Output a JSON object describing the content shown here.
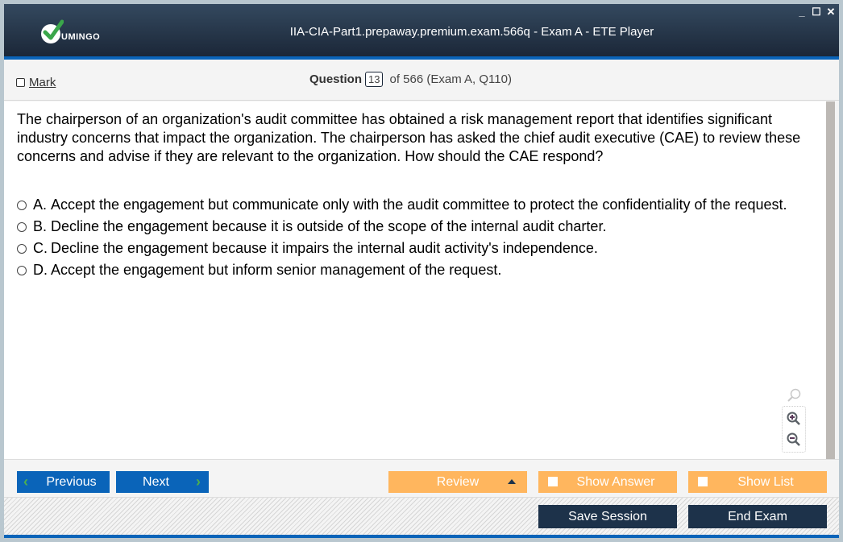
{
  "window": {
    "title": "IIA-CIA-Part1.prepaway.premium.exam.566q - Exam A - ETE Player",
    "logo_text": "UMINGO",
    "controls": {
      "minimize": "_",
      "maximize": "☐",
      "close": "✕"
    }
  },
  "header": {
    "mark_label": "Mark",
    "question_label": "Question",
    "question_number": "13",
    "question_info": "of 566 (Exam A, Q110)"
  },
  "question": {
    "text": "The chairperson of an organization's audit committee has obtained a risk management report that identifies significant industry concerns that impact the organization. The chairperson has asked the chief audit executive (CAE) to review these concerns and advise if they are relevant to the organization. How should the CAE respond?",
    "answers": [
      {
        "letter": "A.",
        "text": "Accept the engagement but communicate only with the audit committee to protect the confidentiality of the request."
      },
      {
        "letter": "B.",
        "text": "Decline the engagement because it is outside of the scope of the internal audit charter."
      },
      {
        "letter": "C.",
        "text": "Decline the engagement because it impairs the internal audit activity's independence."
      },
      {
        "letter": "D.",
        "text": "Accept the engagement but inform senior management of the request."
      }
    ]
  },
  "zoom_tools": {
    "search_icon": "magnifier-icon",
    "zoom_in_icon": "zoom-in-icon",
    "zoom_out_icon": "zoom-out-icon"
  },
  "nav": {
    "previous_label": "Previous",
    "next_label": "Next",
    "review_label": "Review",
    "show_answer_label": "Show Answer",
    "show_list_label": "Show List"
  },
  "footer": {
    "save_session_label": "Save Session",
    "end_exam_label": "End Exam"
  },
  "colors": {
    "titlebar": "#1b2738",
    "accent_blue": "#0a64b9",
    "orange": "#ffb65e",
    "dark_button": "#1d324a",
    "logo_green": "#3aa64a"
  }
}
